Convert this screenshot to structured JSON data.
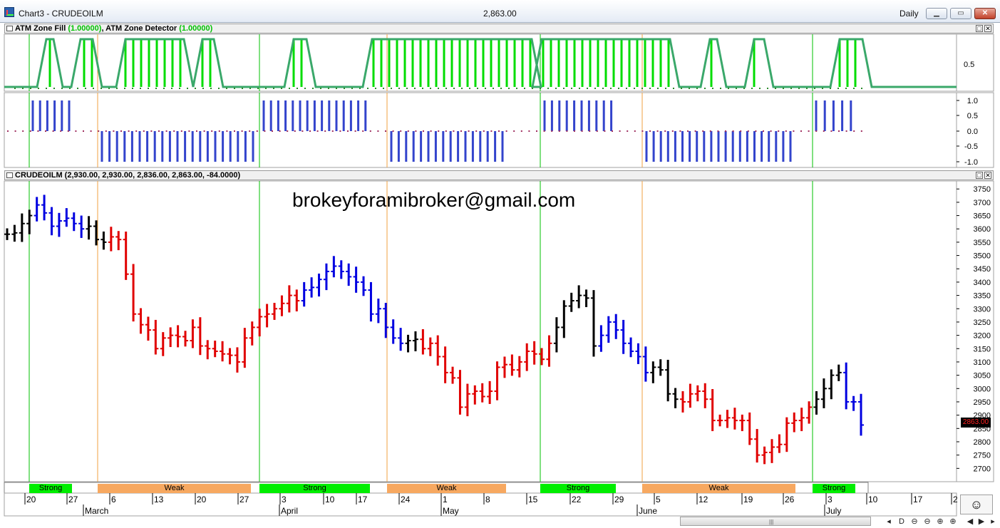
{
  "window": {
    "title": "Chart3 - CRUDEOILM",
    "price": "2,863.00",
    "interval": "Daily"
  },
  "panes": {
    "zone": {
      "title_part1": "ATM Zone Fill ",
      "title_val1": "(1.00000)",
      "title_part2": ", ATM Zone Detector ",
      "title_val2": "(1.00000)",
      "yticks": [
        "0.5"
      ]
    },
    "detector": {
      "yticks": [
        "1.0",
        "0.5",
        "0.0",
        "-0.5",
        "-1.0"
      ]
    },
    "price": {
      "title": "CRUDEOILM (2,930.00, 2,930.00, 2,836.00, 2,863.00, -84.0000)",
      "yticks": [
        "3750",
        "3700",
        "3650",
        "3600",
        "3550",
        "3500",
        "3450",
        "3400",
        "3350",
        "3300",
        "3250",
        "3200",
        "3150",
        "3100",
        "3050",
        "3000",
        "2950",
        "2900",
        "2850",
        "2800",
        "2750",
        "2700"
      ],
      "last_price": "2863.00",
      "watermark": "brokeyforamibroker@gmail.com"
    }
  },
  "zones": [
    {
      "label": "Strong",
      "color": "#00ee00"
    },
    {
      "label": "Weak",
      "color": "#f7a860"
    },
    {
      "label": "Strong",
      "color": "#00ee00"
    },
    {
      "label": "Weak",
      "color": "#f7a860"
    },
    {
      "label": "Strong",
      "color": "#00ee00"
    },
    {
      "label": "Weak",
      "color": "#f7a860"
    },
    {
      "label": "Strong",
      "color": "#00ee00"
    }
  ],
  "date_axis": {
    "days": [
      "20",
      "27",
      "6",
      "13",
      "20",
      "27",
      "3",
      "10",
      "17",
      "24",
      "1",
      "8",
      "15",
      "22",
      "29",
      "5",
      "12",
      "19",
      "26",
      "3",
      "10",
      "17",
      "2"
    ],
    "months": [
      "March",
      "April",
      "May",
      "June",
      "July"
    ]
  },
  "colors": {
    "up": "#0000e0",
    "down": "#e00000",
    "neutral": "#000000",
    "zone_fill": "#00dd00",
    "zone_line": "#3aa86a",
    "detector_bar": "#3344cc",
    "strong_line": "#00c000",
    "weak_line": "#f0a040"
  },
  "chart_data": {
    "type": "ohlc",
    "symbol": "CRUDEOILM",
    "ylim": [
      2650,
      3780
    ],
    "last": {
      "open": 2930,
      "high": 2930,
      "low": 2836,
      "close": 2863,
      "change": -84
    },
    "closes": [
      3580,
      3585,
      3620,
      3650,
      3690,
      3660,
      3610,
      3630,
      3640,
      3620,
      3600,
      3610,
      3560,
      3550,
      3570,
      3560,
      3430,
      3280,
      3240,
      3220,
      3150,
      3190,
      3200,
      3195,
      3180,
      3230,
      3160,
      3150,
      3140,
      3130,
      3125,
      3100,
      3190,
      3230,
      3270,
      3280,
      3300,
      3320,
      3350,
      3330,
      3370,
      3380,
      3410,
      3440,
      3460,
      3440,
      3420,
      3400,
      3370,
      3280,
      3300,
      3230,
      3190,
      3170,
      3180,
      3185,
      3150,
      3170,
      3120,
      3060,
      3040,
      2930,
      2980,
      2990,
      2970,
      2990,
      3080,
      3090,
      3070,
      3100,
      3140,
      3130,
      3110,
      3170,
      3230,
      3310,
      3330,
      3350,
      3340,
      3160,
      3200,
      3250,
      3220,
      3170,
      3140,
      3120,
      3060,
      3080,
      3070,
      2980,
      2960,
      2950,
      2980,
      2990,
      2960,
      2880,
      2880,
      2890,
      2880,
      2880,
      2810,
      2750,
      2760,
      2780,
      2790,
      2870,
      2880,
      2890,
      2930,
      2960,
      3000,
      3050,
      3060,
      2950,
      2950,
      2863
    ],
    "bar_color_codes": "nnnnuuuuuuunnndddddddddddddddddddddddddduuuuuuuuuuuuuunnddddddddddddddddddnnnnnnuuuuuuunnnnddddddddddddddddddnnnnuuuuun",
    "zone_fill_spans": [
      [
        70,
        75
      ],
      [
        118,
        130
      ],
      [
        176,
        258
      ],
      [
        284,
        300
      ],
      [
        412,
        430
      ],
      [
        524,
        746
      ],
      [
        762,
        940
      ],
      [
        998,
        1004
      ],
      [
        1058,
        1068
      ],
      [
        1178,
        1210
      ]
    ],
    "zone_peaks": [
      70,
      118,
      182,
      234,
      290,
      418,
      430,
      528,
      710,
      768,
      834,
      894,
      1000,
      1066,
      1184
    ],
    "detector_groups": [
      {
        "sign": 1,
        "from": 46,
        "to": 97,
        "step": 10.2
      },
      {
        "sign": -1,
        "from": 143,
        "to": 356,
        "step": 10.6
      },
      {
        "sign": 1,
        "from": 370,
        "to": 513,
        "step": 10.2
      },
      {
        "sign": -1,
        "from": 549,
        "to": 705,
        "step": 10.4
      },
      {
        "sign": 1,
        "from": 764,
        "to": 858,
        "step": 10.4
      },
      {
        "sign": -1,
        "from": 907,
        "to": 1110,
        "step": 10.1
      },
      {
        "sign": 1,
        "from": 1145,
        "to": 1194,
        "step": 12.2
      }
    ]
  }
}
